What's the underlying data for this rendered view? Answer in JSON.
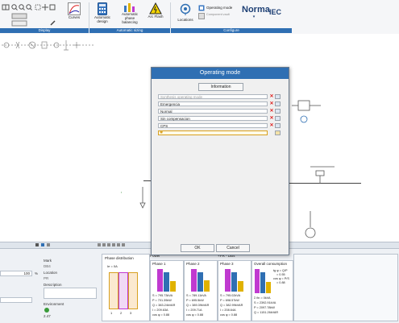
{
  "ribbon": {
    "groups": [
      {
        "label": "Display"
      },
      {
        "label": "Automatic sizing"
      },
      {
        "label": "Configure"
      }
    ],
    "buttons": {
      "curves": "Curves",
      "automatic_design": "Automatic design",
      "automatic_phase_balancing": "Automatic phase balancing",
      "arc_flash": "Arc Flash",
      "locations": "Locations",
      "operating_mode": "Operating mode",
      "component_vault": "Component vault",
      "norma": "Norma",
      "iec": "IEC"
    }
  },
  "dialog": {
    "title": "Operating mode",
    "information_button": "Information",
    "rows": [
      {
        "text": "Synthesis operating mode",
        "dim": true
      },
      {
        "text": "Emergencia"
      },
      {
        "text": "Normal"
      },
      {
        "text": "Sin compensacion"
      },
      {
        "text": "CPS"
      },
      {
        "text": ""
      }
    ],
    "ok": "OK",
    "cancel": "Cancel"
  },
  "properties": {
    "percent": "100",
    "percent_unit": "%",
    "mark_label": "Mark",
    "mark_value": "DB4",
    "location_label": "Location",
    "location_value": "PR",
    "description_label": "Description",
    "environment_label": "Environment",
    "environment_value": "2.47"
  },
  "phase_distribution": {
    "title": "Phase distribution",
    "legend": "Ie = 0A",
    "bars": [
      "1",
      "2",
      "3"
    ]
  },
  "power": {
    "title": "Power",
    "subtitle": "+PR - DB4",
    "phases": [
      {
        "title": "Phase 1",
        "s": "S = 795.73kVA",
        "p": "P = 701.39kW",
        "q": "Q = 383.24kVAR",
        "i": "I = 209.63A",
        "cos": "cos φ = 0.88"
      },
      {
        "title": "Phase 2",
        "s": "S = 789.11kVA",
        "p": "P = 695.5kW",
        "q": "Q = 389.39kVAR",
        "i": "I = 209.71A",
        "cos": "cos φ = 0.88"
      },
      {
        "title": "Phase 3",
        "s": "S = 795.02kVA",
        "p": "P = 698.57kW",
        "q": "Q = 382.99kVAR",
        "i": "I = 208.64A",
        "cos": "cos φ = 0.88"
      }
    ],
    "overall": {
      "title": "Overall consumption",
      "lines": [
        "tg φ = Q/P",
        "= 0.55",
        "cos φ = P/S",
        "= 0.88",
        "Σ fin = 0kVA",
        "S = 2392.91kVA",
        "P = 2097.78kW",
        "Q = 1151.26kVAR"
      ]
    }
  }
}
